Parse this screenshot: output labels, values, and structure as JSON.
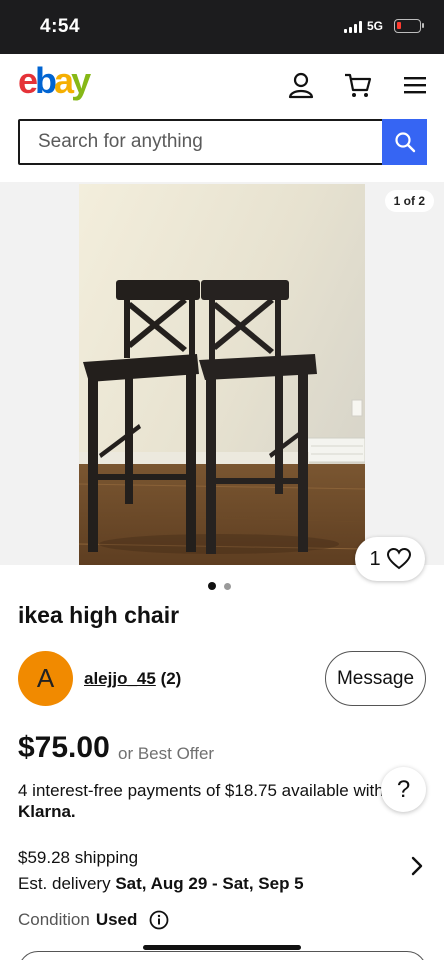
{
  "status_bar": {
    "time": "4:54",
    "network": "5G",
    "battery_level": 0.1,
    "battery_color": "#ff3b30"
  },
  "header": {
    "logo_letters": [
      "e",
      "b",
      "a",
      "y"
    ],
    "logo_colors": [
      "#e53238",
      "#0064d2",
      "#f5af02",
      "#86b817"
    ],
    "icons": [
      "account-icon",
      "cart-icon",
      "menu-icon"
    ]
  },
  "search": {
    "placeholder": "Search for anything",
    "button_icon": "search-icon",
    "accent": "#3665f3"
  },
  "gallery": {
    "counter": "1 of 2",
    "watch_count": "1",
    "dots_total": 2,
    "dots_active": 1
  },
  "listing": {
    "title": "ikea high chair",
    "seller": {
      "avatar_letter": "A",
      "username": "alejjo_45",
      "feedback": "(2)",
      "message_label": "Message"
    },
    "price": "$75.00",
    "best_offer": "or Best Offer",
    "klarna_text": "4 interest-free payments of $18.75 available with",
    "klarna_brand": "Klarna.",
    "help_label": "?",
    "shipping_cost": "$59.28 shipping",
    "delivery_prefix": "Est. delivery",
    "delivery_range": "Sat, Aug 29 - Sat, Sep 5",
    "condition_label": "Condition",
    "condition_value": "Used"
  }
}
